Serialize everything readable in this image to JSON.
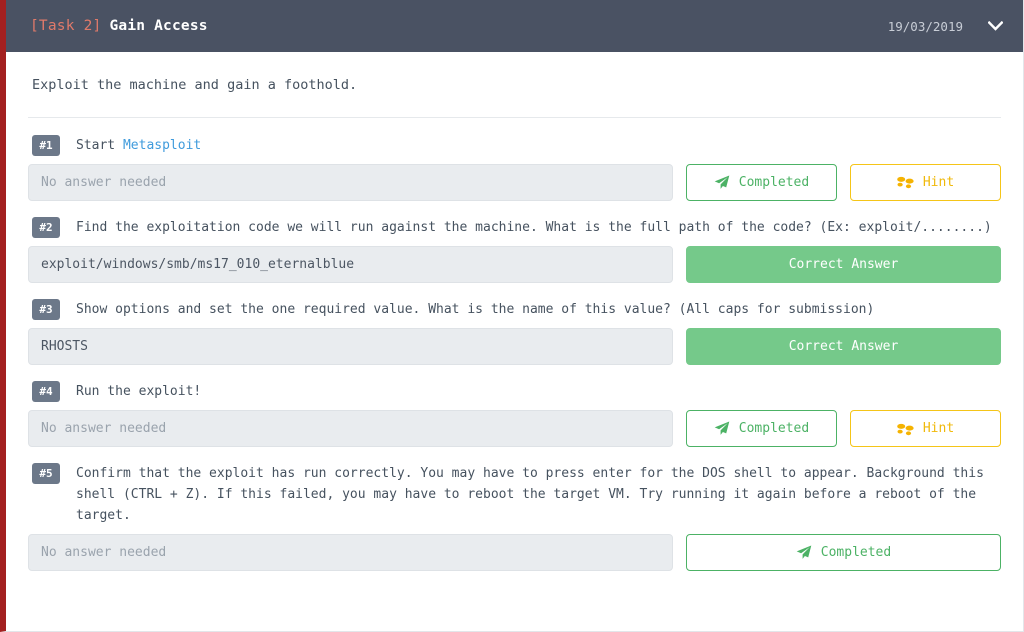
{
  "header": {
    "task_tag": "[Task 2]",
    "title": "Gain Access",
    "date": "19/03/2019",
    "collapse_icon": "chevron-down-icon",
    "accent_color": "#a32020",
    "background_color": "#4a5263"
  },
  "description": "Exploit the machine and gain a foothold.",
  "questions": [
    {
      "number": "#1",
      "text_before": "Start ",
      "link_text": "Metasploit",
      "text_after": "",
      "answer_value": "No answer needed",
      "answer_is_placeholder": true,
      "buttons": [
        {
          "label": "Completed",
          "icon": "paper-plane-icon",
          "style": "completed"
        },
        {
          "label": "Hint",
          "icon": "shoe-prints-icon",
          "style": "hint"
        }
      ]
    },
    {
      "number": "#2",
      "text_before": "Find the exploitation code we will run against the machine. What is the full path of the code? (Ex: exploit/........)",
      "link_text": "",
      "text_after": "",
      "answer_value": "exploit/windows/smb/ms17_010_eternalblue",
      "answer_is_placeholder": false,
      "buttons": [
        {
          "label": "Correct Answer",
          "icon": "",
          "style": "correct"
        }
      ]
    },
    {
      "number": "#3",
      "text_before": "Show options and set the one required value. What is the name of this value? (All caps for submission)",
      "link_text": "",
      "text_after": "",
      "answer_value": "RHOSTS",
      "answer_is_placeholder": false,
      "buttons": [
        {
          "label": "Correct Answer",
          "icon": "",
          "style": "correct"
        }
      ]
    },
    {
      "number": "#4",
      "text_before": "Run the exploit!",
      "link_text": "",
      "text_after": "",
      "answer_value": "No answer needed",
      "answer_is_placeholder": true,
      "buttons": [
        {
          "label": "Completed",
          "icon": "paper-plane-icon",
          "style": "completed"
        },
        {
          "label": "Hint",
          "icon": "shoe-prints-icon",
          "style": "hint"
        }
      ]
    },
    {
      "number": "#5",
      "text_before": "Confirm that the exploit has run correctly. You may have to press enter for the DOS shell to appear. Background this shell (CTRL + Z). If this failed, you may have to reboot the target VM. Try running it again before a reboot of the target.",
      "link_text": "",
      "text_after": "",
      "answer_value": "No answer needed",
      "answer_is_placeholder": true,
      "buttons": [
        {
          "label": "Completed",
          "icon": "paper-plane-icon",
          "style": "completed-wide"
        }
      ]
    }
  ],
  "colors": {
    "correct_green": "#75c98a",
    "completed_green": "#4cb265",
    "hint_yellow": "#f0b90b",
    "link_blue": "#3f9bdc",
    "badge_grey": "#6c7889"
  }
}
